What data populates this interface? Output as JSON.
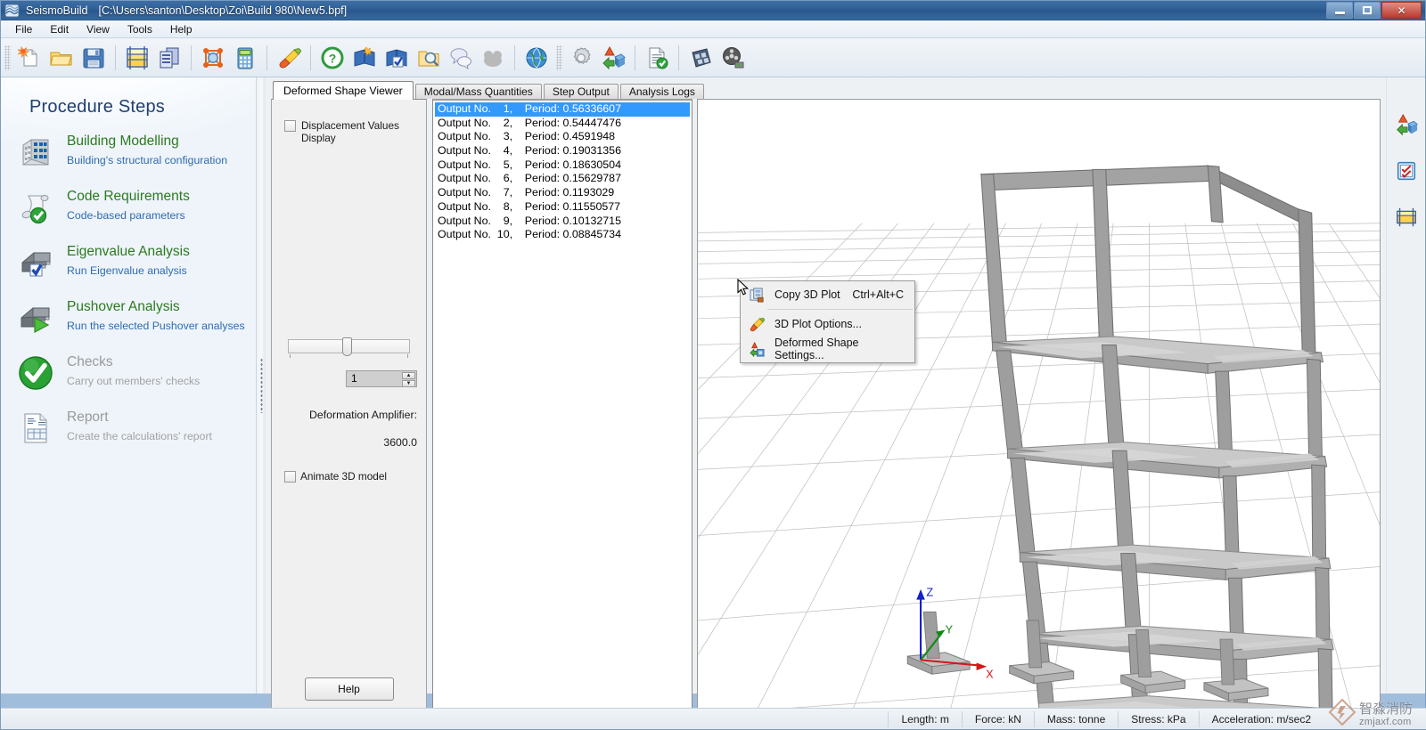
{
  "window": {
    "app_title": "SeismoBuild",
    "file_path": "[C:\\Users\\santon\\Desktop\\Zoi\\Build 980\\New5.bpf]",
    "minimize_label": "Minimize",
    "maximize_label": "Restore",
    "close_label": "Close"
  },
  "menu": {
    "items": [
      "File",
      "Edit",
      "View",
      "Tools",
      "Help"
    ]
  },
  "toolbar": {
    "groups": [
      {
        "buttons": [
          {
            "name": "new-project-icon",
            "tip": "New project"
          },
          {
            "name": "open-project-icon",
            "tip": "Open project"
          },
          {
            "name": "save-project-icon",
            "tip": "Save project"
          }
        ]
      },
      {
        "buttons": [
          {
            "name": "building-modelling-icon",
            "tip": "Building Modelling"
          },
          {
            "name": "code-requirements-icon",
            "tip": "Code Requirements"
          }
        ]
      },
      {
        "buttons": [
          {
            "name": "eigenvalue-analysis-icon",
            "tip": "Eigenvalue Analysis"
          },
          {
            "name": "calculator-icon",
            "tip": "Calculator"
          }
        ]
      },
      {
        "buttons": [
          {
            "name": "paintbrush-icon",
            "tip": "Display settings"
          }
        ]
      },
      {
        "buttons": [
          {
            "name": "help-icon",
            "tip": "Help"
          },
          {
            "name": "manual-icon",
            "tip": "User manual"
          },
          {
            "name": "checked-book-icon",
            "tip": "Verification report"
          },
          {
            "name": "browse-examples-icon",
            "tip": "Browse examples"
          },
          {
            "name": "support-chat-icon",
            "tip": "Support"
          },
          {
            "name": "disabled-icon",
            "tip": ""
          }
        ]
      },
      {
        "buttons": [
          {
            "name": "globe-icon",
            "tip": "Website"
          }
        ]
      },
      {
        "buttons": [
          {
            "name": "settings-gear-icon",
            "tip": "Settings"
          },
          {
            "name": "3d-plot-options-icon",
            "tip": "3D Plot Options"
          }
        ]
      },
      {
        "buttons": [
          {
            "name": "report-check-icon",
            "tip": "Report"
          }
        ]
      },
      {
        "buttons": [
          {
            "name": "film-strip-icon",
            "tip": "Animation"
          },
          {
            "name": "film-reel-play-icon",
            "tip": "Play animation"
          }
        ]
      }
    ]
  },
  "sidebar": {
    "title": "Procedure Steps",
    "steps": [
      {
        "icon": "building-icon",
        "title": "Building Modelling",
        "subtitle": "Building's structural configuration",
        "enabled": true
      },
      {
        "icon": "scroll-check-icon",
        "title": "Code Requirements",
        "subtitle": "Code-based parameters",
        "enabled": true
      },
      {
        "icon": "eigenvalue-check-icon",
        "title": "Eigenvalue Analysis",
        "subtitle": "Run Eigenvalue analysis",
        "enabled": true
      },
      {
        "icon": "pushover-play-icon",
        "title": "Pushover Analysis",
        "subtitle": "Run the selected Pushover analyses",
        "enabled": true
      },
      {
        "icon": "green-check-icon",
        "title": "Checks",
        "subtitle": "Carry out members' checks",
        "enabled": false
      },
      {
        "icon": "report-page-icon",
        "title": "Report",
        "subtitle": "Create the calculations' report",
        "enabled": false
      }
    ]
  },
  "tabs": {
    "items": [
      "Deformed Shape Viewer",
      "Modal/Mass Quantities",
      "Step Output",
      "Analysis Logs"
    ],
    "active_index": 0
  },
  "controls": {
    "displacement_checkbox_label": "Displacement Values\nDisplay",
    "displacement_checked": false,
    "slider_value": 1,
    "slider_min": 1,
    "slider_max": 10,
    "spinner_value": "1",
    "amplifier_label": "Deformation Amplifier:",
    "amplifier_value": "3600.0",
    "animate_checkbox_label": "Animate 3D model",
    "animate_checked": false,
    "help_button_label": "Help"
  },
  "output_list": {
    "selected_index": 0,
    "items": [
      {
        "label": "Output No.",
        "number": "1,",
        "period_label": "Period:",
        "period": "0.56336607"
      },
      {
        "label": "Output No.",
        "number": "2,",
        "period_label": "Period:",
        "period": "0.54447476"
      },
      {
        "label": "Output No.",
        "number": "3,",
        "period_label": "Period:",
        "period": "0.4591948"
      },
      {
        "label": "Output No.",
        "number": "4,",
        "period_label": "Period:",
        "period": "0.19031356"
      },
      {
        "label": "Output No.",
        "number": "5,",
        "period_label": "Period:",
        "period": "0.18630504"
      },
      {
        "label": "Output No.",
        "number": "6,",
        "period_label": "Period:",
        "period": "0.15629787"
      },
      {
        "label": "Output No.",
        "number": "7,",
        "period_label": "Period:",
        "period": "0.1193029"
      },
      {
        "label": "Output No.",
        "number": "8,",
        "period_label": "Period:",
        "period": "0.11550577"
      },
      {
        "label": "Output No.",
        "number": "9,",
        "period_label": "Period:",
        "period": "0.10132715"
      },
      {
        "label": "Output No.",
        "number": "10,",
        "period_label": "Period:",
        "period": "0.08845734"
      }
    ],
    "rendered": [
      "Output No.    1,    Period: 0.56336607",
      "Output No.    2,    Period: 0.54447476",
      "Output No.    3,    Period: 0.4591948",
      "Output No.    4,    Period: 0.19031356",
      "Output No.    5,    Period: 0.18630504",
      "Output No.    6,    Period: 0.15629787",
      "Output No.    7,    Period: 0.1193029",
      "Output No.    8,    Period: 0.11550577",
      "Output No.    9,    Period: 0.10132715",
      "Output No.  10,    Period: 0.08845734"
    ]
  },
  "viewport": {
    "axis_x_label": "X",
    "axis_y_label": "Y",
    "axis_z_label": "Z",
    "axis_x_color": "#d31818",
    "axis_y_color": "#128a12",
    "axis_z_color": "#1420c8",
    "model_fill": "#9a9a9a",
    "slab_fill": "#c4c4c4",
    "grid_color": "#b9b9b9",
    "background": "#ffffff"
  },
  "context_menu": {
    "items": [
      {
        "icon": "copy-3d-plot-icon",
        "label": "Copy 3D Plot",
        "accel": "Ctrl+Alt+C"
      },
      {
        "icon": "paintbrush-icon",
        "label": "3D Plot Options...",
        "accel": ""
      },
      {
        "icon": "deformed-shape-settings-icon",
        "label": "Deformed Shape Settings...",
        "accel": ""
      }
    ]
  },
  "right_tools": [
    {
      "name": "3d-plot-options-button",
      "icon": "3d-axes-cube-icon"
    },
    {
      "name": "checks-button",
      "icon": "blue-checklist-icon"
    },
    {
      "name": "beam-section-button",
      "icon": "yellow-beam-icon"
    }
  ],
  "statusbar": {
    "cells": [
      "Length: m",
      "Force: kN",
      "Mass: tonne",
      "Stress: kPa",
      "Acceleration: m/sec2"
    ]
  },
  "watermark": {
    "cn": "智淼消防",
    "en": "zmjaxf.com"
  }
}
